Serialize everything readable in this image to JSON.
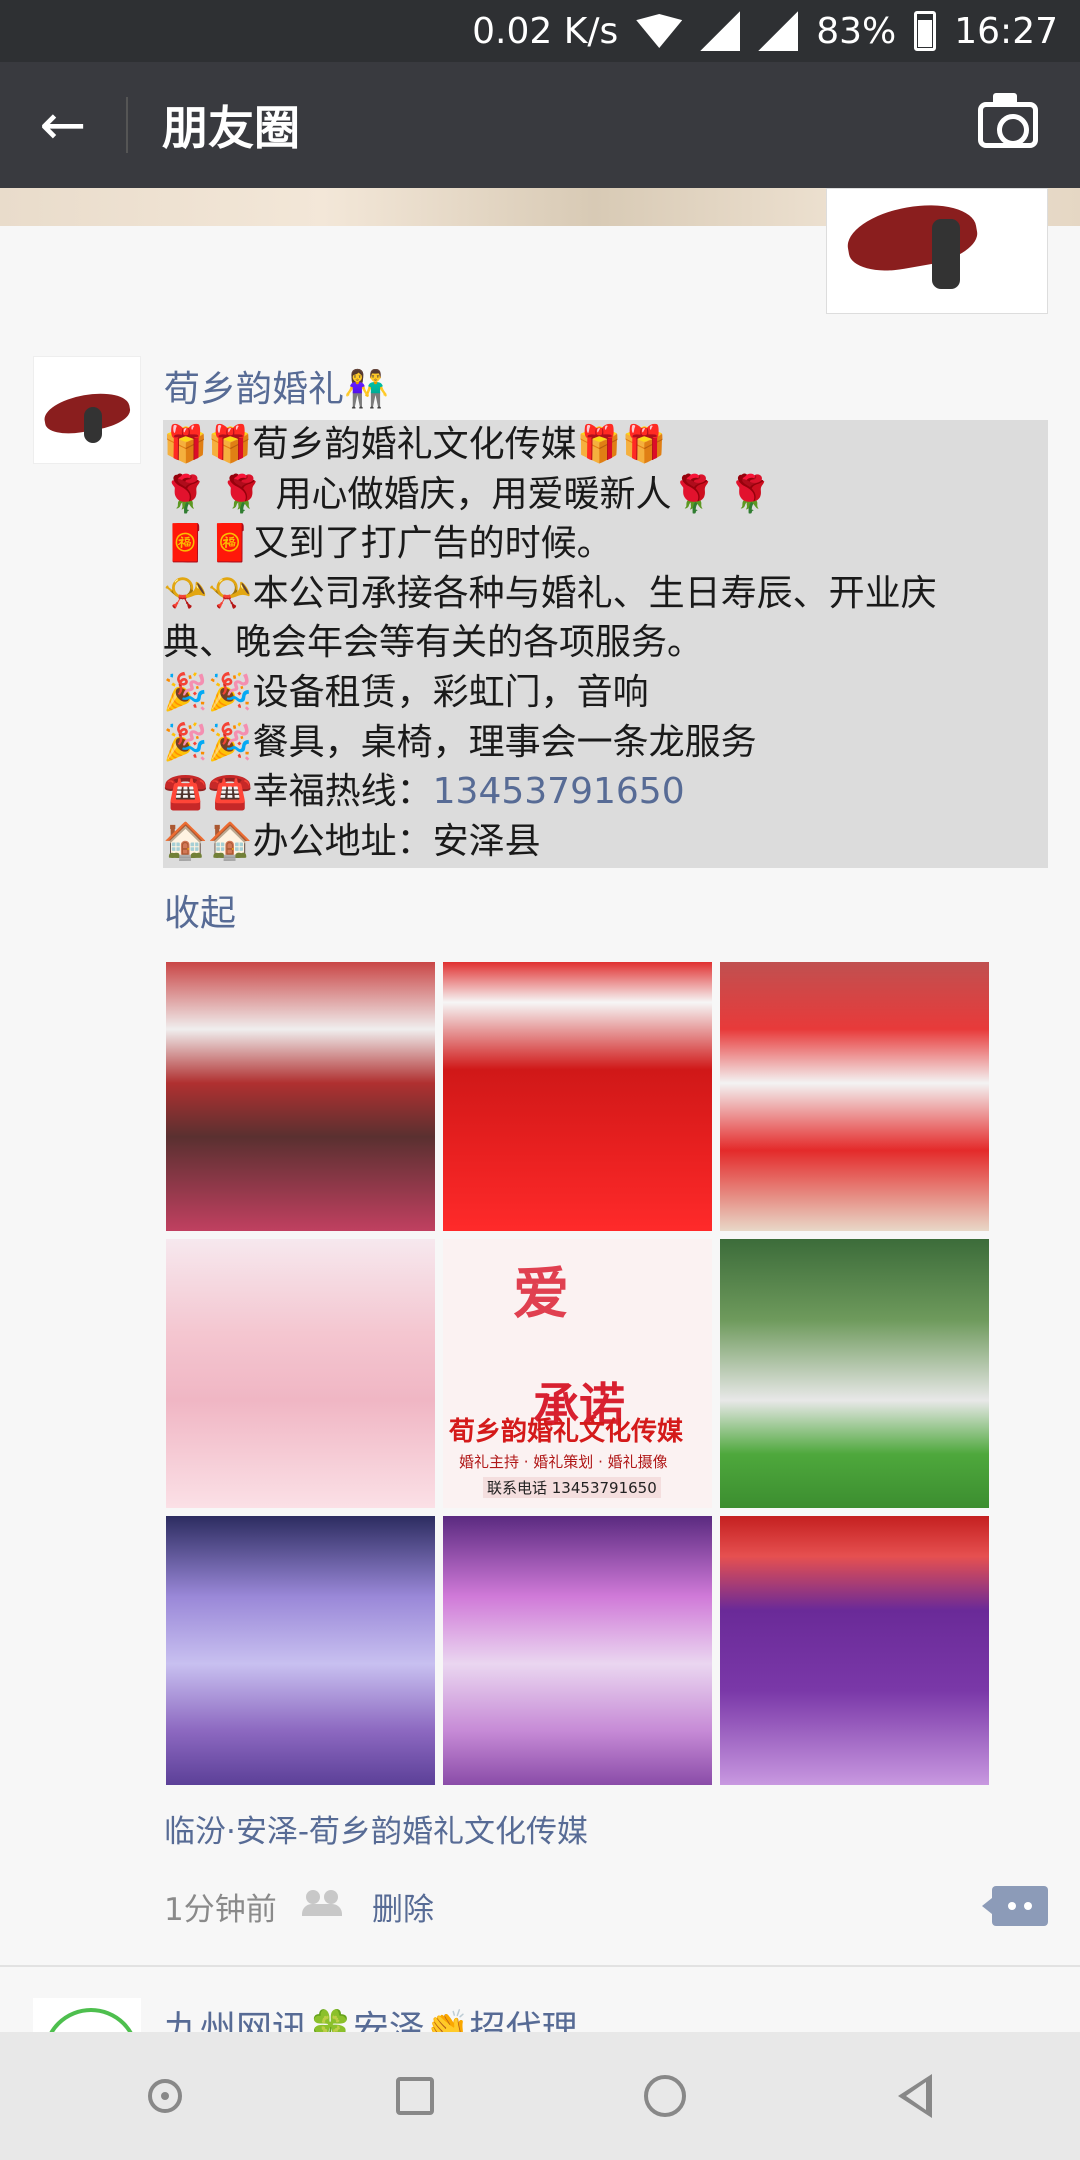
{
  "status_bar": {
    "speed": "0.02 K/s",
    "battery": "83%",
    "time": "16:27"
  },
  "header": {
    "title": "朋友圈"
  },
  "post": {
    "author": "荀乡韵婚礼👫",
    "lines": [
      "🎁🎁荀乡韵婚礼文化传媒🎁🎁",
      "🌹 🌹 用心做婚庆，用爱暖新人🌹 🌹",
      "🧧🧧又到了打广告的时候。",
      "📯📯本公司承接各种与婚礼、生日寿辰、开业庆",
      "典、晚会年会等有关的各项服务。",
      "🎉🎉设备租赁，彩虹门，音响",
      "🎉🎉餐具，桌椅，理事会一条龙服务",
      "☎️☎️幸福热线：",
      "🏠🏠办公地址：安泽县"
    ],
    "phone": "13453791650",
    "collapse_label": "收起",
    "poster": {
      "big_text_1": "爱",
      "big_text_2": "承诺",
      "brand": "荀乡韵婚礼文化传媒",
      "sub": "婚礼主持 · 婚礼策划 · 婚礼摄像",
      "tel": "联系电话 13453791650"
    },
    "location": "临汾·安泽-荀乡韵婚礼文化传媒",
    "time": "1分钟前",
    "delete_label": "删除"
  },
  "next_post": {
    "author": "九州网讯🍀安泽👏招代理"
  }
}
